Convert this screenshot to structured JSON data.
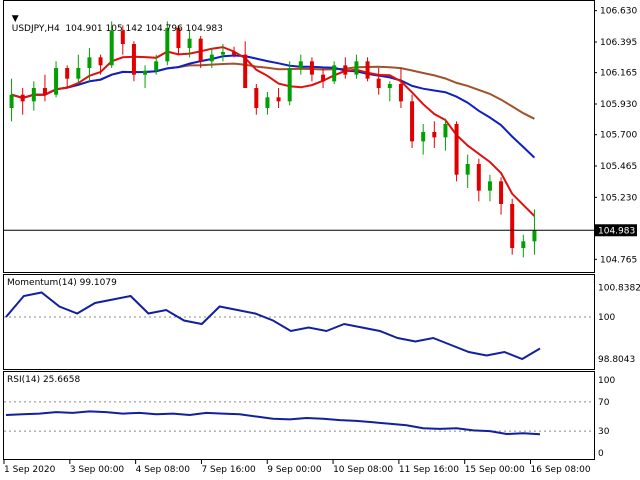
{
  "symbol_header": {
    "arrow": "▼",
    "text": "USDJPY,H4  104.901 105.142 104.796 104.983"
  },
  "main_pane": {
    "price_axis": [
      "106.630",
      "106.395",
      "106.165",
      "105.930",
      "105.700",
      "105.465",
      "105.230",
      "104.765"
    ],
    "current_price": "104.983",
    "colors": {
      "bull": "#00a000",
      "bear": "#e00000",
      "ma_fast": "#e01010",
      "ma_mid": "#1020c0",
      "ma_slow": "#a0522d"
    }
  },
  "momentum_pane": {
    "label": "Momentum(14) 99.1079",
    "axis": [
      "100.8382",
      "100",
      "98.8043"
    ]
  },
  "rsi_pane": {
    "label": "RSI(14) 25.6658",
    "axis": [
      "100",
      "70",
      "30",
      "0"
    ]
  },
  "time_axis": [
    "1 Sep 2020",
    "3 Sep 00:00",
    "4 Sep 08:00",
    "7 Sep 16:00",
    "9 Sep 00:00",
    "10 Sep 08:00",
    "11 Sep 16:00",
    "15 Sep 00:00",
    "16 Sep 08:00"
  ],
  "chart_data": {
    "type": "candlestick",
    "symbol": "USDJPY",
    "timeframe": "H4",
    "ylim": [
      104.7,
      106.68
    ],
    "candles": [
      [
        105.9,
        106.12,
        105.8,
        106.0
      ],
      [
        106.0,
        106.05,
        105.85,
        105.95
      ],
      [
        105.95,
        106.1,
        105.88,
        106.05
      ],
      [
        106.05,
        106.15,
        105.95,
        106.0
      ],
      [
        106.0,
        106.25,
        105.98,
        106.2
      ],
      [
        106.2,
        106.22,
        106.05,
        106.12
      ],
      [
        106.12,
        106.3,
        106.08,
        106.2
      ],
      [
        106.2,
        106.35,
        106.1,
        106.28
      ],
      [
        106.28,
        106.3,
        106.15,
        106.22
      ],
      [
        106.22,
        106.55,
        106.2,
        106.48
      ],
      [
        106.48,
        106.52,
        106.3,
        106.38
      ],
      [
        106.38,
        106.4,
        106.1,
        106.15
      ],
      [
        106.15,
        106.22,
        106.05,
        106.18
      ],
      [
        106.18,
        106.3,
        106.15,
        106.25
      ],
      [
        106.25,
        106.55,
        106.22,
        106.5
      ],
      [
        106.5,
        106.52,
        106.3,
        106.35
      ],
      [
        106.35,
        106.48,
        106.28,
        106.42
      ],
      [
        106.42,
        106.44,
        106.2,
        106.25
      ],
      [
        106.25,
        106.35,
        106.2,
        106.3
      ],
      [
        106.3,
        106.38,
        106.25,
        106.32
      ],
      [
        106.32,
        106.36,
        106.28,
        106.3
      ],
      [
        106.3,
        106.4,
        106.1,
        106.05
      ],
      [
        106.05,
        106.08,
        105.85,
        105.9
      ],
      [
        105.9,
        106.02,
        105.85,
        105.98
      ],
      [
        105.98,
        106.05,
        105.9,
        105.95
      ],
      [
        105.95,
        106.25,
        105.92,
        106.2
      ],
      [
        106.2,
        106.3,
        106.15,
        106.25
      ],
      [
        106.25,
        106.28,
        106.1,
        106.15
      ],
      [
        106.15,
        106.2,
        106.05,
        106.1
      ],
      [
        106.1,
        106.25,
        106.08,
        106.22
      ],
      [
        106.22,
        106.28,
        106.12,
        106.15
      ],
      [
        106.15,
        106.3,
        106.12,
        106.25
      ],
      [
        106.25,
        106.28,
        106.1,
        106.12
      ],
      [
        106.12,
        106.2,
        106.0,
        106.05
      ],
      [
        106.05,
        106.1,
        105.95,
        106.08
      ],
      [
        106.08,
        106.2,
        105.9,
        105.95
      ],
      [
        105.95,
        106.0,
        105.6,
        105.65
      ],
      [
        105.65,
        105.78,
        105.55,
        105.72
      ],
      [
        105.72,
        105.8,
        105.6,
        105.68
      ],
      [
        105.68,
        105.82,
        105.58,
        105.78
      ],
      [
        105.78,
        105.8,
        105.35,
        105.4
      ],
      [
        105.4,
        105.55,
        105.3,
        105.48
      ],
      [
        105.48,
        105.52,
        105.2,
        105.28
      ],
      [
        105.28,
        105.4,
        105.2,
        105.35
      ],
      [
        105.35,
        105.38,
        105.1,
        105.18
      ],
      [
        105.18,
        105.22,
        104.8,
        104.85
      ],
      [
        104.85,
        104.95,
        104.78,
        104.9
      ],
      [
        104.9,
        105.14,
        104.8,
        104.98
      ]
    ],
    "momentum": [
      100.0,
      100.6,
      100.7,
      100.3,
      100.1,
      100.4,
      100.5,
      100.6,
      100.1,
      100.2,
      99.9,
      99.8,
      100.3,
      100.2,
      100.1,
      99.9,
      99.6,
      99.7,
      99.6,
      99.8,
      99.7,
      99.6,
      99.4,
      99.3,
      99.4,
      99.2,
      99.0,
      98.9,
      99.0,
      98.8,
      99.1
    ],
    "rsi": [
      52,
      53,
      54,
      56,
      55,
      57,
      56,
      54,
      55,
      53,
      54,
      52,
      55,
      54,
      53,
      50,
      47,
      46,
      48,
      47,
      45,
      44,
      42,
      40,
      38,
      34,
      33,
      34,
      31,
      30,
      26,
      27,
      25.7
    ],
    "momentum_ylim": [
      98.6,
      101.0
    ],
    "rsi_ylim": [
      0,
      100
    ]
  }
}
